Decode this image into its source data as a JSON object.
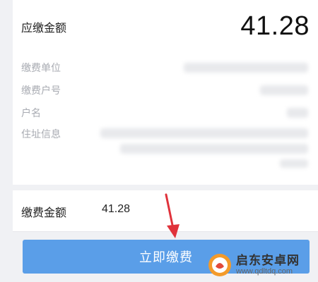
{
  "summary": {
    "amount_label": "应缴金额",
    "amount_value": "41.28"
  },
  "info": {
    "rows": [
      {
        "label": "缴费单位"
      },
      {
        "label": "缴费户号"
      },
      {
        "label": "户名"
      },
      {
        "label": "住址信息"
      }
    ]
  },
  "payment": {
    "label": "缴费金额",
    "value": "41.28"
  },
  "action": {
    "button_label": "立即缴费"
  },
  "watermark": {
    "name": "启东安卓网",
    "url": "www.qdltdq.com"
  },
  "colors": {
    "button": "#5a9ee8",
    "arrow": "#e0323b",
    "background": "#f0f1f4"
  },
  "icons": {
    "arrow": "red-pointer-arrow",
    "watermark_logo": "orange-circle-logo"
  }
}
